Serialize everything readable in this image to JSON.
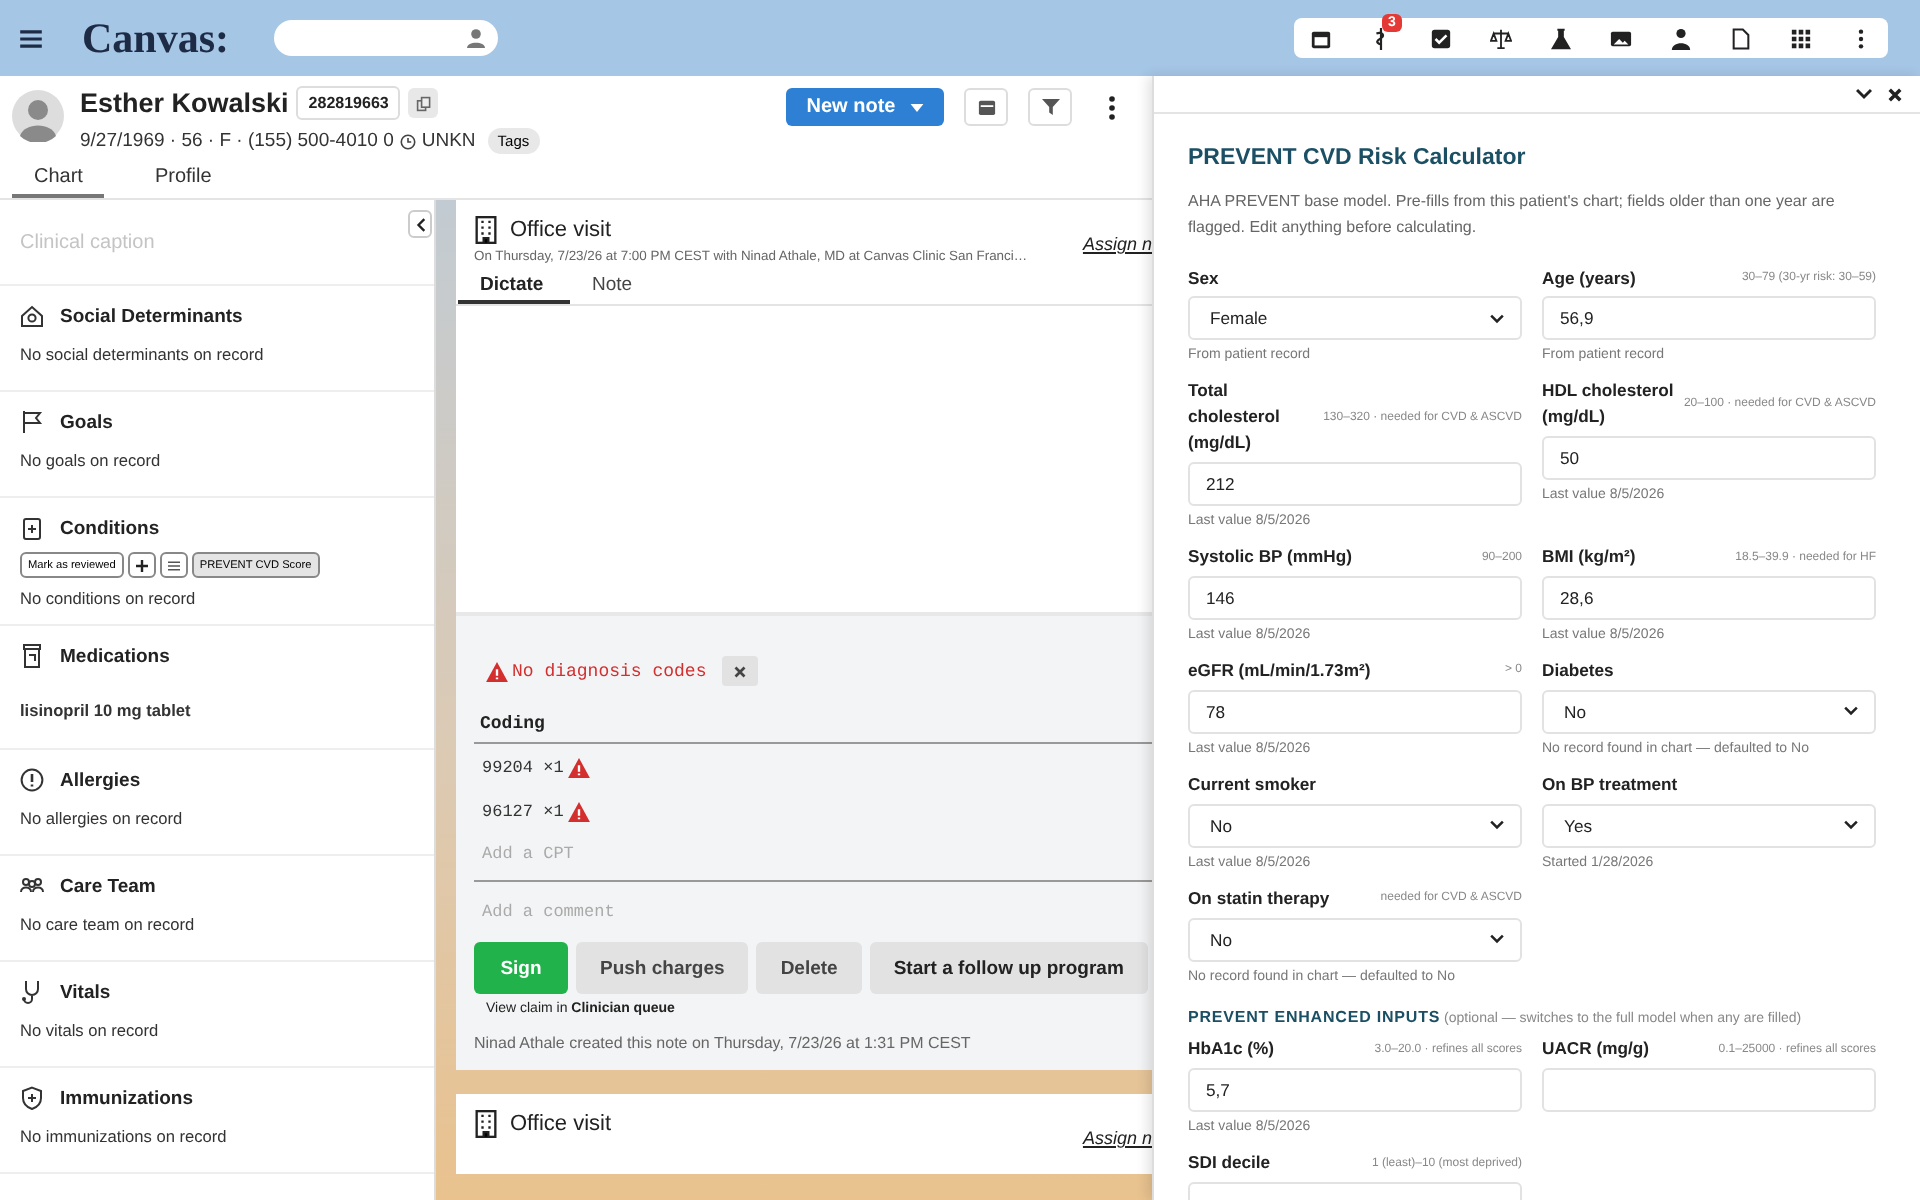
{
  "topbar": {
    "logo": "Canvas:",
    "toolbar_badge": "3"
  },
  "patient": {
    "name": "Esther Kowalski",
    "mrn": "282819663",
    "details": "9/27/1969 · 56 · F · (155) 500-4010 0",
    "timezone": "UNKN",
    "tag": "Tags",
    "new_note": "New note",
    "tabs": [
      {
        "label": "Chart",
        "selected": true
      },
      {
        "label": "Profile",
        "selected": false
      }
    ]
  },
  "sidebar": {
    "caption_placeholder": "Clinical caption",
    "sections": [
      {
        "title": "Social Determinants",
        "entry": "No social determinants on record",
        "kind": "empty"
      },
      {
        "title": "Goals",
        "entry": "No goals on record",
        "kind": "empty"
      },
      {
        "title": "Conditions",
        "entry": "No conditions on record",
        "kind": "empty",
        "actions": [
          "Mark as reviewed",
          "PREVENT CVD Score"
        ]
      },
      {
        "title": "Medications",
        "entry": "lisinopril 10 mg tablet",
        "kind": "item"
      },
      {
        "title": "Allergies",
        "entry": "No allergies on record",
        "kind": "empty"
      },
      {
        "title": "Care Team",
        "entry": "No care team on record",
        "kind": "empty"
      },
      {
        "title": "Vitals",
        "entry": "No vitals on record",
        "kind": "empty"
      },
      {
        "title": "Immunizations",
        "entry": "No immunizations on record",
        "kind": "empty"
      }
    ]
  },
  "note": {
    "title": "Office visit",
    "subtitle": "On Thursday, 7/23/26 at 7:00 PM CEST with Ninad Athale, MD at Canvas Clinic San Franci…",
    "assign": "Assign n",
    "tabs": [
      {
        "label": "Dictate",
        "selected": true
      },
      {
        "label": "Note",
        "selected": false
      }
    ],
    "warning": "No diagnosis codes",
    "coding_heading": "Coding",
    "codes": [
      {
        "code": "99204 ×1"
      },
      {
        "code": "96127 ×1"
      }
    ],
    "cpt_placeholder": "Add a CPT",
    "comment_placeholder": "Add a comment",
    "buttons": [
      {
        "label": "Sign",
        "kind": "primary"
      },
      {
        "label": "Push charges",
        "kind": "secondary"
      },
      {
        "label": "Delete",
        "kind": "secondary"
      },
      {
        "label": "Start a follow up program",
        "kind": "secondary"
      }
    ],
    "claim": "View claim in **Clinician queue**",
    "footer": "Ninad Athale created this note on Thursday, 7/23/26 at 1:31 PM CEST"
  },
  "next_note": {
    "title": "Office visit",
    "assign": "Assign n"
  },
  "panel": {
    "title": "PREVENT CVD Risk Calculator",
    "description": "AHA PREVENT base model. Pre-fills from this patient's chart; fields older than one year are flagged. Edit anything before calculating.",
    "fields": [
      {
        "label": "Sex",
        "kind": "select",
        "value": "Female",
        "note": "From patient record"
      },
      {
        "label": "Age (years)",
        "hint": "30–79 (30-yr risk: 30–59)",
        "kind": "input",
        "value": "56,9",
        "note": "From patient record"
      },
      {
        "label": "Total cholesterol (mg/dL)",
        "hint": "130–320 · needed for CVD & ASCVD",
        "kind": "input",
        "value": "212",
        "note": "Last value 8/5/2026"
      },
      {
        "label": "HDL cholesterol (mg/dL)",
        "hint": "20–100 · needed for CVD & ASCVD",
        "kind": "input",
        "value": "50",
        "note": "Last value 8/5/2026"
      },
      {
        "label": "Systolic BP (mmHg)",
        "hint": "90–200",
        "kind": "input",
        "value": "146",
        "note": "Last value 8/5/2026"
      },
      {
        "label": "BMI (kg/m²)",
        "hint": "18.5–39.9 · needed for HF",
        "kind": "input",
        "value": "28,6",
        "note": "Last value 8/5/2026"
      },
      {
        "label": "eGFR (mL/min/1.73m²)",
        "hint": "> 0",
        "kind": "input",
        "value": "78",
        "note": "Last value 8/5/2026"
      },
      {
        "label": "Diabetes",
        "kind": "select",
        "value": "No",
        "note": "No record found in chart — defaulted to No"
      },
      {
        "label": "Current smoker",
        "kind": "select",
        "value": "No",
        "note": "Last value 8/5/2026"
      },
      {
        "label": "On BP treatment",
        "kind": "select",
        "value": "Yes",
        "note": "Started 1/28/2026"
      },
      {
        "label": "On statin therapy",
        "hint": "needed for CVD & ASCVD",
        "kind": "select",
        "value": "No",
        "note": "No record found in chart — defaulted to No"
      }
    ],
    "enhanced_heading": "PREVENT ENHANCED INPUTS",
    "enhanced_note": "(optional — switches to the full model when any are filled)",
    "enhanced_fields": [
      {
        "label": "HbA1c (%)",
        "hint": "3.0–20.0 · refines all scores",
        "kind": "input",
        "value": "5,7",
        "note": "Last value 8/5/2026"
      },
      {
        "label": "UACR (mg/g)",
        "hint": "0.1–25000 · refines all scores",
        "kind": "input"
      },
      {
        "label": "SDI decile",
        "hint": "1 (least)–10 (most deprived)",
        "kind": "input"
      }
    ]
  }
}
